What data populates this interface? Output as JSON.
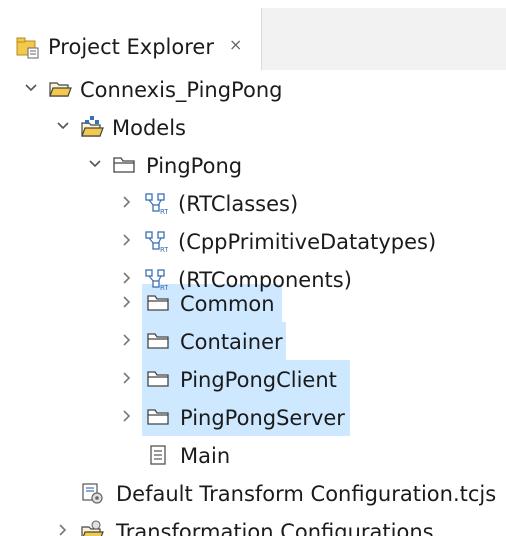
{
  "tab": {
    "title": "Project Explorer",
    "close_icon": "close-icon"
  },
  "tree": {
    "items": [
      {
        "label": "Connexis_PingPong",
        "icon": "project-folder-icon",
        "expanded": true
      },
      {
        "label": "Models",
        "icon": "models-folder-icon",
        "expanded": true
      },
      {
        "label": "PingPong",
        "icon": "folder-icon",
        "expanded": true
      },
      {
        "label": "(RTClasses)",
        "icon": "model-library-icon",
        "expanded": false
      },
      {
        "label": "(CppPrimitiveDatatypes)",
        "icon": "model-library-icon",
        "expanded": false
      },
      {
        "label": "(RTComponents)",
        "icon": "model-library-icon",
        "expanded": false
      },
      {
        "label": "Common",
        "icon": "folder-icon",
        "expanded": false,
        "selected": true
      },
      {
        "label": "Container",
        "icon": "folder-icon",
        "expanded": false,
        "selected": true
      },
      {
        "label": "PingPongClient",
        "icon": "folder-icon",
        "expanded": false,
        "selected": true
      },
      {
        "label": "PingPongServer",
        "icon": "folder-icon",
        "expanded": false,
        "selected": true
      },
      {
        "label": "Main",
        "icon": "diagram-file-icon"
      },
      {
        "label": "Default Transform Configuration.tcjs",
        "icon": "transform-config-icon"
      },
      {
        "label": "Transformation Configurations",
        "icon": "transformation-folder-icon",
        "expanded": false
      }
    ]
  },
  "colors": {
    "selection": "#cde8ff",
    "folder_outline": "#444444",
    "project_folder": "#f2c94c",
    "model_icon": "#3b6fb6"
  }
}
